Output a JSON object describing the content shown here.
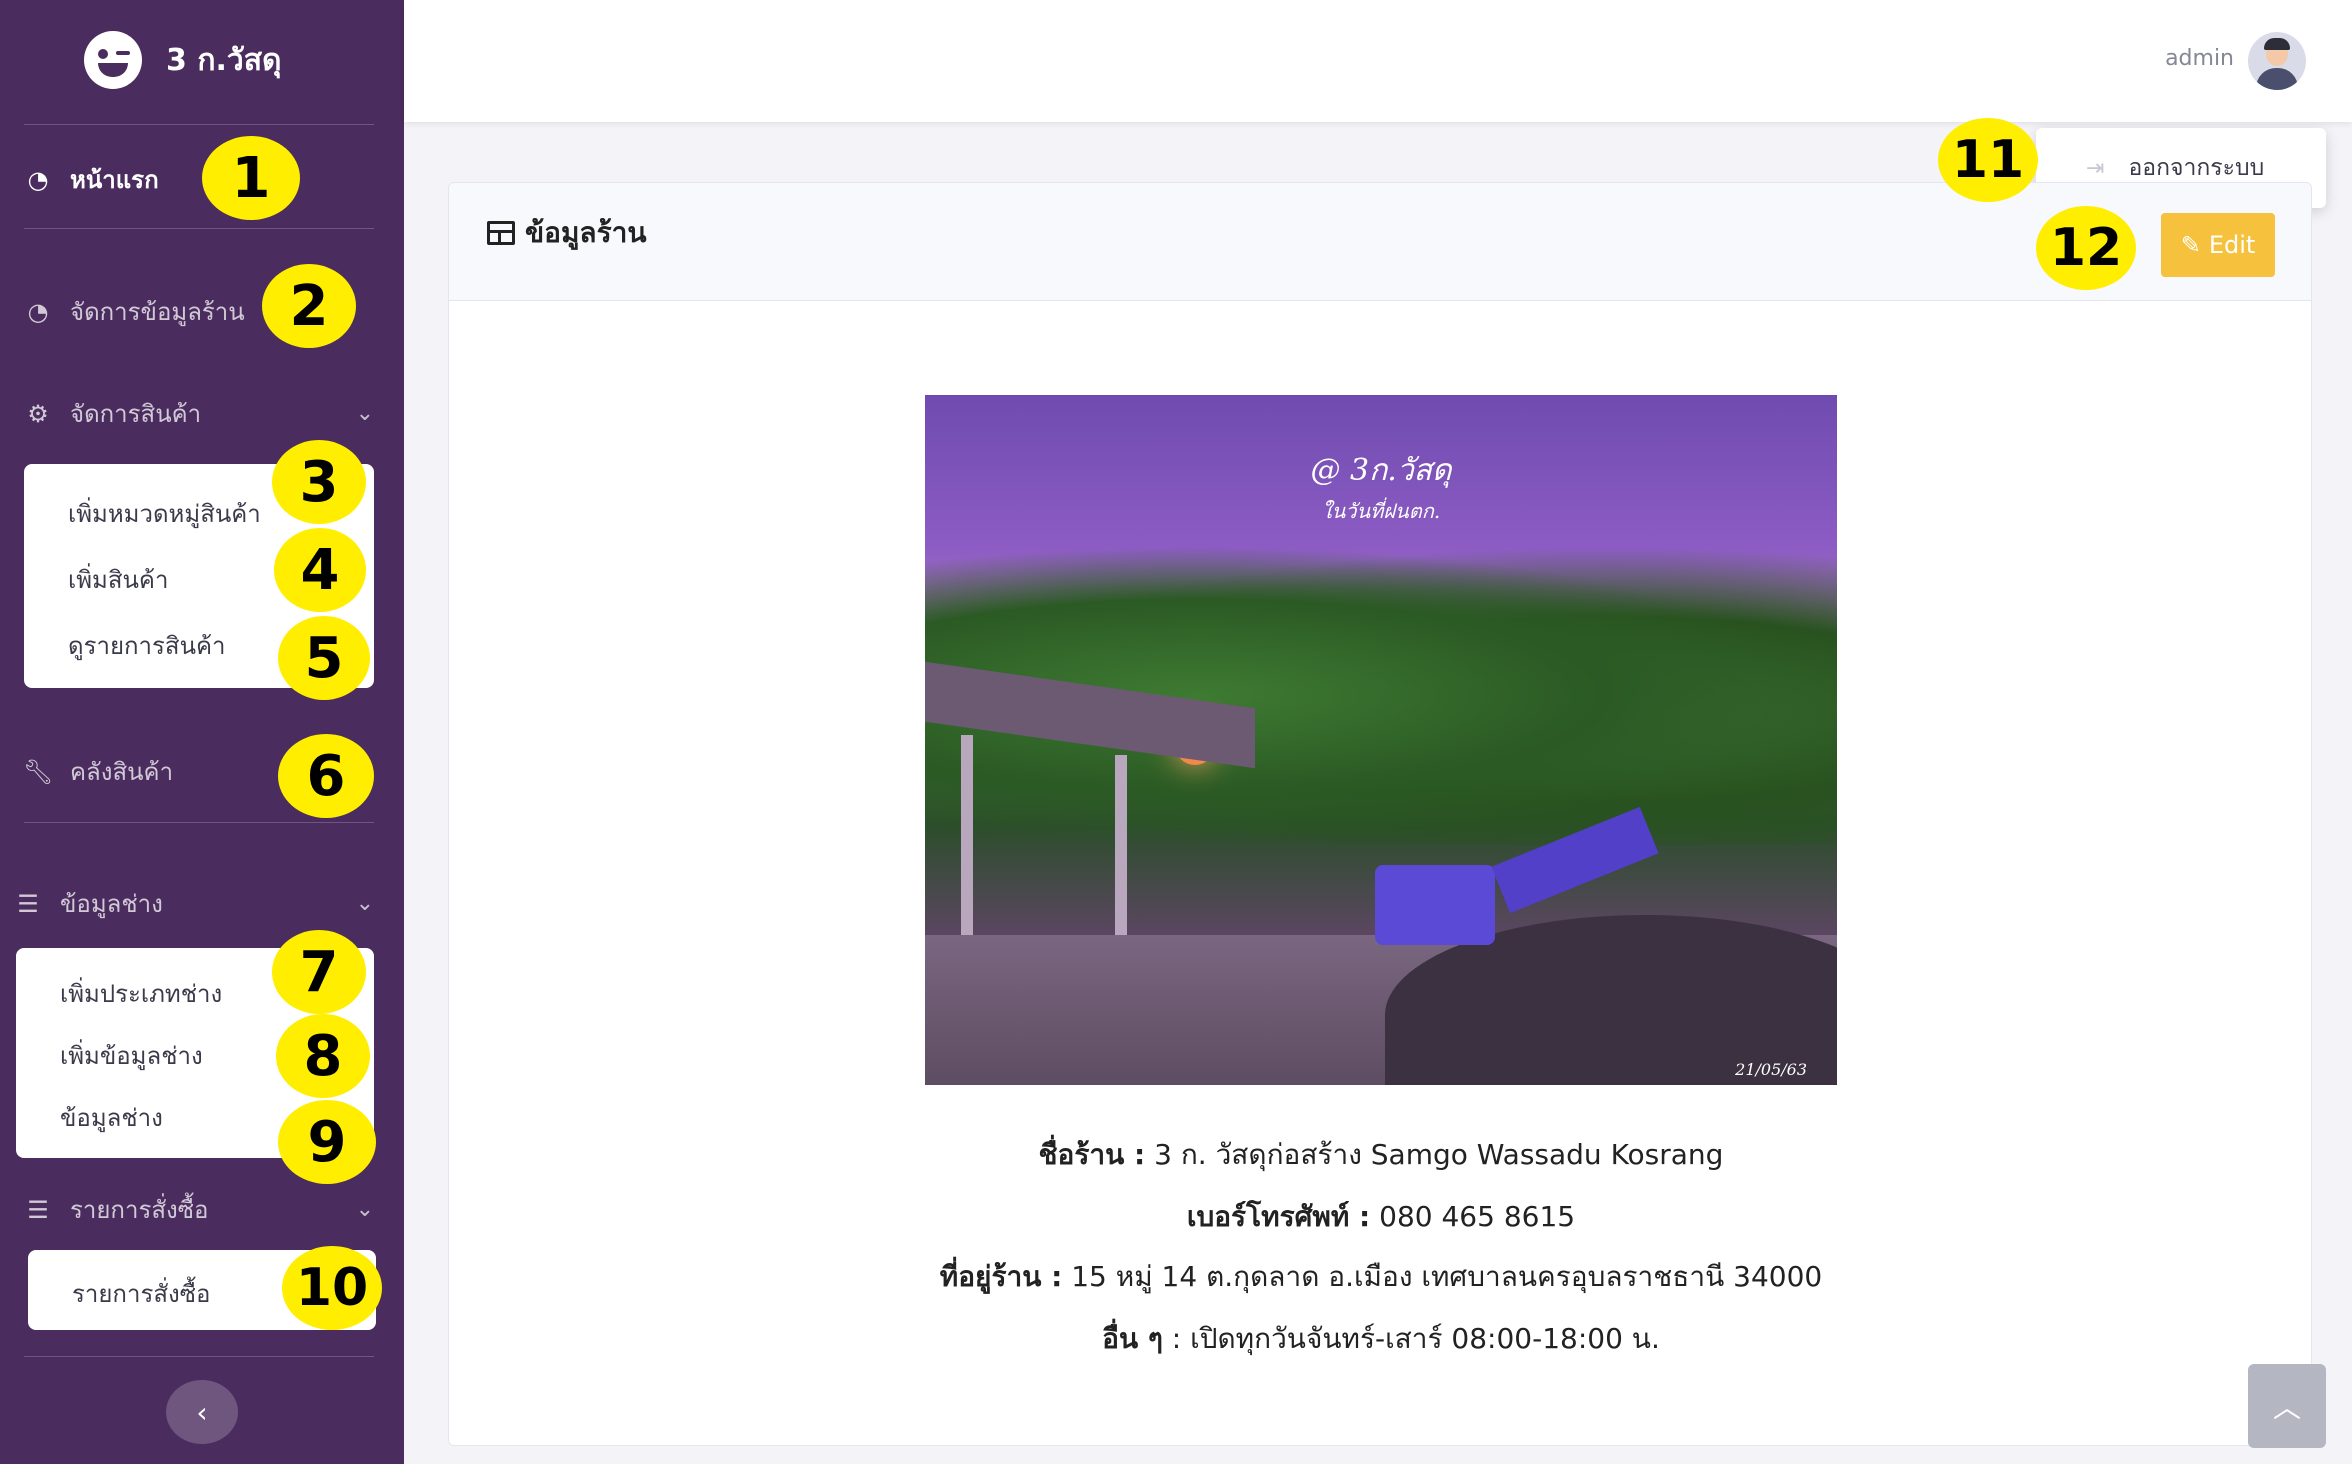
{
  "brand": {
    "title": "3 ก.วัสดุ"
  },
  "sidebar": {
    "home": "หน้าแรก",
    "manage_shop": "จัดการข้อมูลร้าน",
    "manage_products": {
      "label": "จัดการสินค้า",
      "items": [
        "เพิ่มหมวดหมู่สินค้า",
        "เพิ่มสินค้า",
        "ดูรายการสินค้า"
      ]
    },
    "warehouse": "คลังสินค้า",
    "technicians": {
      "label": "ข้อมูลช่าง",
      "items": [
        "เพิ่มประเภทช่าง",
        "เพิ่มข้อมูลช่าง",
        "ข้อมูลช่าง"
      ]
    },
    "orders": {
      "label": "รายการสั่งซื้อ",
      "items": [
        "รายการสั่งซื้อ"
      ]
    }
  },
  "badges": [
    "1",
    "2",
    "3",
    "4",
    "5",
    "6",
    "7",
    "8",
    "9",
    "10",
    "11",
    "12"
  ],
  "topbar": {
    "user": "admin"
  },
  "dropdown": {
    "logout": "ออกจากระบบ"
  },
  "card": {
    "title": "ข้อมูลร้าน",
    "edit_label": "Edit"
  },
  "photo": {
    "watermark_line1": "@ 3ก.วัสดุ",
    "watermark_line2": "ในวันที่ฝนตก.",
    "date": "21/05/63"
  },
  "shop": {
    "name_label": "ชื่อร้าน :",
    "name_value": " 3 ก. วัสดุก่อสร้าง Samgo Wassadu Kosrang",
    "phone_label": "เบอร์โทรศัพท์ :",
    "phone_value": " 080 465 8615",
    "address_label": "ที่อยู่ร้าน :",
    "address_value": " 15 หมู่ 14 ต.กุดลาด อ.เมือง เทศบาลนครอุบลราชธานี 34000",
    "other_label": "อื่น ๆ",
    "other_value": "    : เปิดทุกวันจันทร์-เสาร์ 08:00-18:00 น."
  },
  "colors": {
    "sidebar_bg": "#4a2c5e",
    "badge": "#ffee00",
    "edit_button": "#f6c23e"
  }
}
